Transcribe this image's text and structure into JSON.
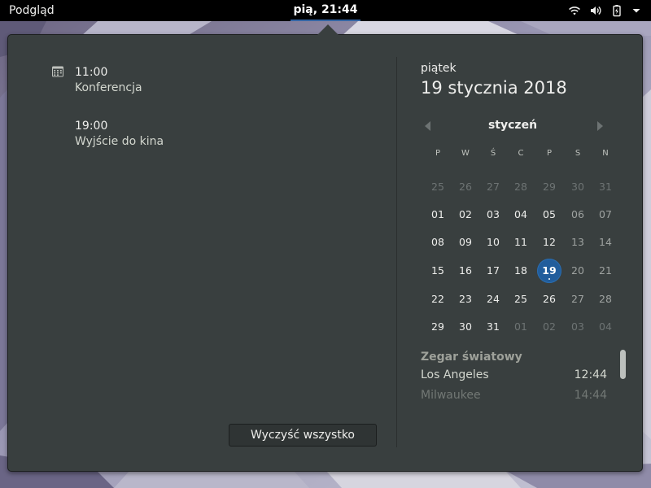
{
  "topbar": {
    "activities_label": "Podgląd",
    "clock": "pią, 21:44",
    "icons": [
      "wifi-icon",
      "volume-icon",
      "battery-icon",
      "menu-arrow-icon"
    ]
  },
  "events": [
    {
      "time": "11:00",
      "title": "Konferencja",
      "icon": "calendar-event-icon"
    },
    {
      "time": "19:00",
      "title": "Wyjście do kina"
    }
  ],
  "clear_button": "Wyczyść wszystko",
  "calendar": {
    "weekday": "piątek",
    "date": "19 stycznia 2018",
    "month": "styczeń",
    "day_headers": [
      "P",
      "W",
      "Ś",
      "C",
      "P",
      "S",
      "N"
    ],
    "weeks": [
      [
        "25",
        "26",
        "27",
        "28",
        "29",
        "30",
        "31"
      ],
      [
        "01",
        "02",
        "03",
        "04",
        "05",
        "06",
        "07"
      ],
      [
        "08",
        "09",
        "10",
        "11",
        "12",
        "13",
        "14"
      ],
      [
        "15",
        "16",
        "17",
        "18",
        "19",
        "20",
        "21"
      ],
      [
        "22",
        "23",
        "24",
        "25",
        "26",
        "27",
        "28"
      ],
      [
        "29",
        "30",
        "31",
        "01",
        "02",
        "03",
        "04"
      ]
    ],
    "other_month_cells": [
      "0-0",
      "0-1",
      "0-2",
      "0-3",
      "0-4",
      "0-5",
      "0-6",
      "5-3",
      "5-4",
      "5-5",
      "5-6"
    ],
    "today_cell": "3-4"
  },
  "world_clock": {
    "title": "Zegar światowy",
    "clocks": [
      {
        "city": "Los Angeles",
        "time": "12:44"
      },
      {
        "city": "Milwaukee",
        "time": "14:44"
      }
    ]
  },
  "colors": {
    "popup_bg": "#393f3f",
    "topbar_bg": "#000000",
    "accent": "#215d9c",
    "clock_underline": "#3465a4"
  }
}
